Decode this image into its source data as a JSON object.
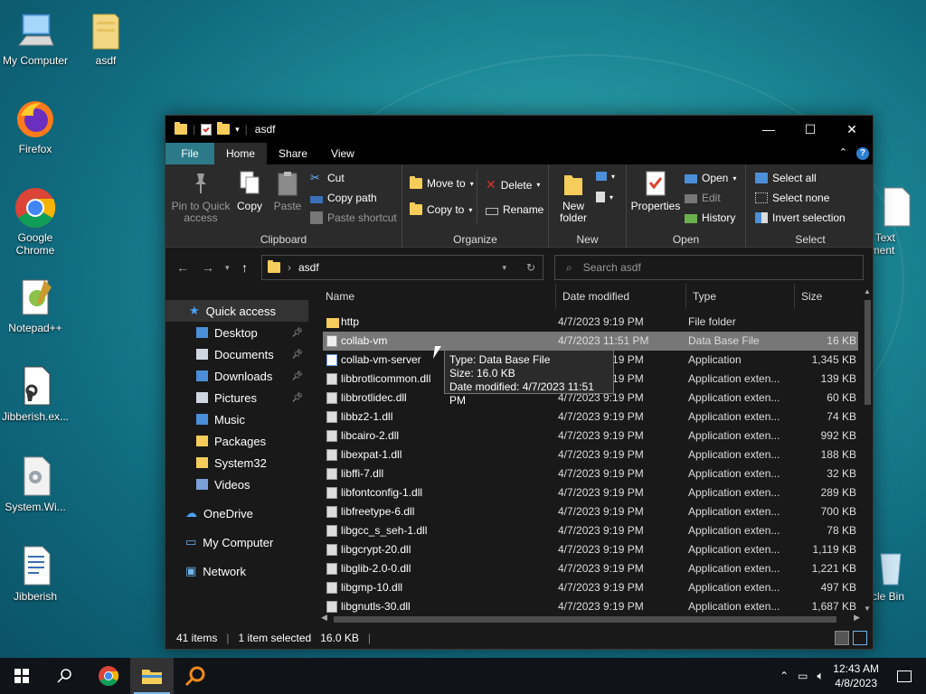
{
  "desktop": {
    "icons": [
      {
        "label": "My Computer"
      },
      {
        "label": "asdf"
      },
      {
        "label": "Firefox"
      },
      {
        "label": "Google Chrome"
      },
      {
        "label": "Notepad++"
      },
      {
        "label": "Jibberish.ex..."
      },
      {
        "label": "System.Wi..."
      },
      {
        "label": "Jibberish"
      },
      {
        "label": "w Text ument"
      },
      {
        "label": "ycle Bin"
      }
    ]
  },
  "window": {
    "title": "asdf",
    "controls": {
      "minimize": "—",
      "maximize": "☐",
      "close": "✕"
    },
    "tabs": [
      {
        "label": "File"
      },
      {
        "label": "Home"
      },
      {
        "label": "Share"
      },
      {
        "label": "View"
      }
    ],
    "ribbon": {
      "clipboard": {
        "group_label": "Clipboard",
        "pin": "Pin to Quick access",
        "copy": "Copy",
        "paste": "Paste",
        "cut": "Cut",
        "copy_path": "Copy path",
        "paste_shortcut": "Paste shortcut"
      },
      "organize": {
        "group_label": "Organize",
        "move_to": "Move to",
        "copy_to": "Copy to",
        "delete": "Delete",
        "rename": "Rename"
      },
      "new": {
        "group_label": "New",
        "new_folder": "New folder"
      },
      "open": {
        "group_label": "Open",
        "properties": "Properties",
        "open": "Open",
        "edit": "Edit",
        "history": "History"
      },
      "select": {
        "group_label": "Select",
        "select_all": "Select all",
        "select_none": "Select none",
        "invert": "Invert selection"
      }
    },
    "address": {
      "path": "asdf",
      "search_placeholder": "Search asdf"
    },
    "nav": {
      "quick_access": "Quick access",
      "items": [
        {
          "label": "Desktop",
          "pinned": true
        },
        {
          "label": "Documents",
          "pinned": true
        },
        {
          "label": "Downloads",
          "pinned": true
        },
        {
          "label": "Pictures",
          "pinned": true
        },
        {
          "label": "Music",
          "pinned": false
        },
        {
          "label": "Packages",
          "pinned": false
        },
        {
          "label": "System32",
          "pinned": false
        },
        {
          "label": "Videos",
          "pinned": false
        }
      ],
      "onedrive": "OneDrive",
      "my_computer": "My Computer",
      "network": "Network"
    },
    "columns": {
      "name": "Name",
      "date": "Date modified",
      "type": "Type",
      "size": "Size"
    },
    "files": [
      {
        "name": "http",
        "date": "4/7/2023 9:19 PM",
        "type": "File folder",
        "size": "",
        "kind": "folder"
      },
      {
        "name": "collab-vm",
        "date": "4/7/2023 11:51 PM",
        "type": "Data Base File",
        "size": "16 KB",
        "kind": "file"
      },
      {
        "name": "collab-vm-server",
        "date": "4/7/2023 9:19 PM",
        "type": "Application",
        "size": "1,345 KB",
        "kind": "app"
      },
      {
        "name": "libbrotlicommon.dll",
        "date": "4/7/2023 9:19 PM",
        "type": "Application exten...",
        "size": "139 KB",
        "kind": "dll"
      },
      {
        "name": "libbrotlidec.dll",
        "date": "4/7/2023 9:19 PM",
        "type": "Application exten...",
        "size": "60 KB",
        "kind": "dll"
      },
      {
        "name": "libbz2-1.dll",
        "date": "4/7/2023 9:19 PM",
        "type": "Application exten...",
        "size": "74 KB",
        "kind": "dll"
      },
      {
        "name": "libcairo-2.dll",
        "date": "4/7/2023 9:19 PM",
        "type": "Application exten...",
        "size": "992 KB",
        "kind": "dll"
      },
      {
        "name": "libexpat-1.dll",
        "date": "4/7/2023 9:19 PM",
        "type": "Application exten...",
        "size": "188 KB",
        "kind": "dll"
      },
      {
        "name": "libffi-7.dll",
        "date": "4/7/2023 9:19 PM",
        "type": "Application exten...",
        "size": "32 KB",
        "kind": "dll"
      },
      {
        "name": "libfontconfig-1.dll",
        "date": "4/7/2023 9:19 PM",
        "type": "Application exten...",
        "size": "289 KB",
        "kind": "dll"
      },
      {
        "name": "libfreetype-6.dll",
        "date": "4/7/2023 9:19 PM",
        "type": "Application exten...",
        "size": "700 KB",
        "kind": "dll"
      },
      {
        "name": "libgcc_s_seh-1.dll",
        "date": "4/7/2023 9:19 PM",
        "type": "Application exten...",
        "size": "78 KB",
        "kind": "dll"
      },
      {
        "name": "libgcrypt-20.dll",
        "date": "4/7/2023 9:19 PM",
        "type": "Application exten...",
        "size": "1,119 KB",
        "kind": "dll"
      },
      {
        "name": "libglib-2.0-0.dll",
        "date": "4/7/2023 9:19 PM",
        "type": "Application exten...",
        "size": "1,221 KB",
        "kind": "dll"
      },
      {
        "name": "libgmp-10.dll",
        "date": "4/7/2023 9:19 PM",
        "type": "Application exten...",
        "size": "497 KB",
        "kind": "dll"
      },
      {
        "name": "libgnutls-30.dll",
        "date": "4/7/2023 9:19 PM",
        "type": "Application exten...",
        "size": "1,687 KB",
        "kind": "dll"
      }
    ],
    "selected_index": 1,
    "tooltip": {
      "type": "Type: Data Base File",
      "size": "Size: 16.0 KB",
      "modified": "Date modified: 4/7/2023 11:51 PM"
    },
    "status": {
      "items": "41 items",
      "selected": "1 item selected",
      "size": "16.0 KB"
    }
  },
  "taskbar": {
    "time": "12:43 AM",
    "date": "4/8/2023"
  },
  "colors": {
    "accent": "#2c7a89",
    "window_bg": "#191919",
    "ribbon_bg": "#2b2b2b",
    "selected_row": "#777777",
    "taskbar_bg": "#101418"
  }
}
